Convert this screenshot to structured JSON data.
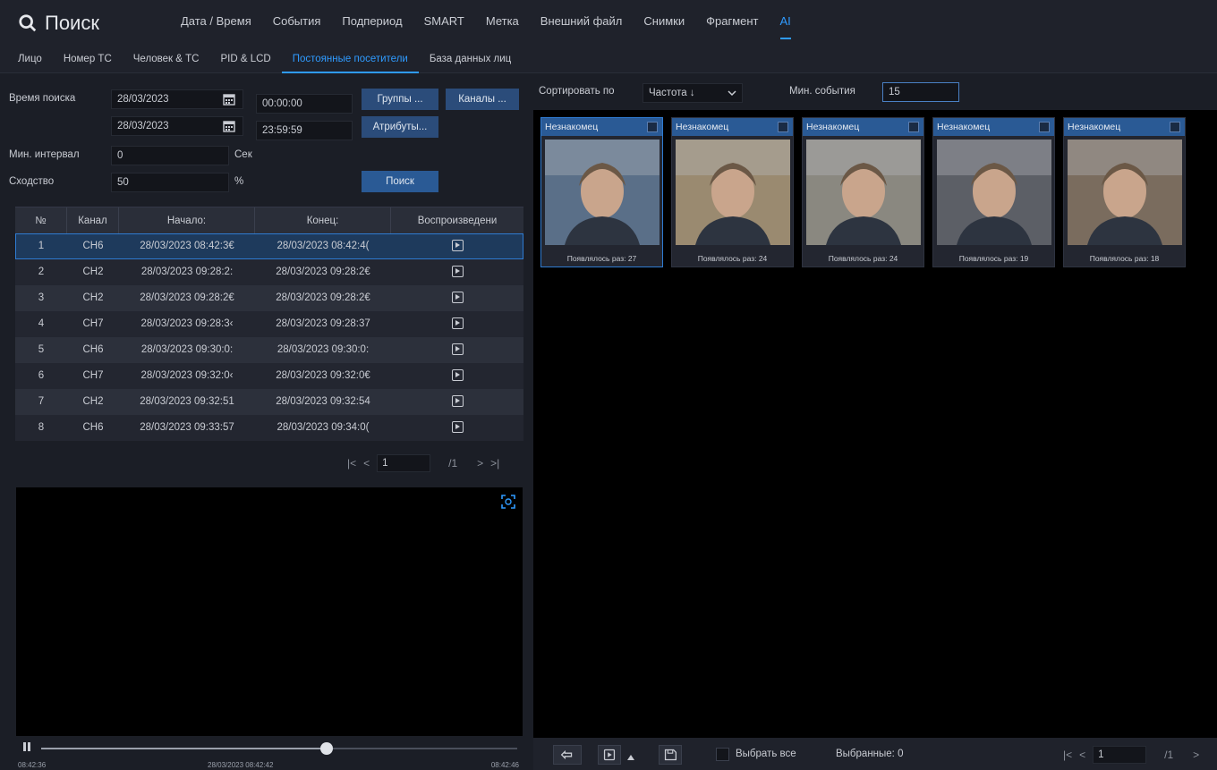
{
  "header": {
    "title": "Поиск",
    "tabs": [
      {
        "label": "Дата / Время",
        "active": false
      },
      {
        "label": "События",
        "active": false
      },
      {
        "label": "Подпериод",
        "active": false
      },
      {
        "label": "SMART",
        "active": false
      },
      {
        "label": "Метка",
        "active": false
      },
      {
        "label": "Внешний файл",
        "active": false
      },
      {
        "label": "Снимки",
        "active": false
      },
      {
        "label": "Фрагмент",
        "active": false
      },
      {
        "label": "AI",
        "active": true
      }
    ]
  },
  "subtabs": [
    {
      "label": "Лицо",
      "active": false
    },
    {
      "label": "Номер ТС",
      "active": false
    },
    {
      "label": "Человек & ТС",
      "active": false
    },
    {
      "label": "PID & LCD",
      "active": false
    },
    {
      "label": "Постоянные посетители",
      "active": true
    },
    {
      "label": "База данных лиц",
      "active": false
    }
  ],
  "search_form": {
    "time_label": "Время поиска",
    "start_date": "28/03/2023",
    "start_time": "00:00:00",
    "end_date": "28/03/2023",
    "end_time": "23:59:59",
    "groups_btn": "Группы ...",
    "channels_btn": "Каналы ...",
    "attributes_btn": "Атрибуты...",
    "min_interval_label": "Мин. интервал",
    "min_interval_value": "0",
    "min_interval_unit": "Сек",
    "similarity_label": "Сходство",
    "similarity_value": "50",
    "similarity_unit": "%",
    "search_btn": "Поиск"
  },
  "table": {
    "headers": [
      "№",
      "Канал",
      "Начало:",
      "Конец:",
      "Воспроизведени"
    ],
    "rows": [
      {
        "n": "1",
        "ch": "CH6",
        "start": "28/03/2023 08:42:3€",
        "end": "28/03/2023 08:42:4(",
        "selected": true
      },
      {
        "n": "2",
        "ch": "CH2",
        "start": "28/03/2023 09:28:2:",
        "end": "28/03/2023 09:28:2€",
        "selected": false
      },
      {
        "n": "3",
        "ch": "CH2",
        "start": "28/03/2023 09:28:2€",
        "end": "28/03/2023 09:28:2€",
        "selected": false
      },
      {
        "n": "4",
        "ch": "CH7",
        "start": "28/03/2023 09:28:3‹",
        "end": "28/03/2023 09:28:37",
        "selected": false
      },
      {
        "n": "5",
        "ch": "CH6",
        "start": "28/03/2023 09:30:0:",
        "end": "28/03/2023 09:30:0:",
        "selected": false
      },
      {
        "n": "6",
        "ch": "CH7",
        "start": "28/03/2023 09:32:0‹",
        "end": "28/03/2023 09:32:0€",
        "selected": false
      },
      {
        "n": "7",
        "ch": "CH2",
        "start": "28/03/2023 09:32:51",
        "end": "28/03/2023 09:32:54",
        "selected": false
      },
      {
        "n": "8",
        "ch": "CH6",
        "start": "28/03/2023 09:33:57",
        "end": "28/03/2023 09:34:0(",
        "selected": false
      }
    ]
  },
  "left_pager": {
    "first": "|<",
    "prev": "<",
    "page": "1",
    "total": "/1",
    "next": ">",
    "last": ">|"
  },
  "playback": {
    "progress": 0.6,
    "time_start": "08:42:36",
    "time_current": "28/03/2023 08:42:42",
    "time_end": "08:42:46"
  },
  "right_panel": {
    "sort_label": "Сортировать по",
    "sort_value": "Частота ↓",
    "min_events_label": "Мин. события",
    "min_events_value": "15",
    "cards": [
      {
        "title": "Незнакомец",
        "caption": "Появлялось раз: 27",
        "selected": true,
        "tone": "#5a6f88"
      },
      {
        "title": "Незнакомец",
        "caption": "Появлялось раз: 24",
        "selected": false,
        "tone": "#9a8a70"
      },
      {
        "title": "Незнакомец",
        "caption": "Появлялось раз: 24",
        "selected": false,
        "tone": "#8a8880"
      },
      {
        "title": "Незнакомец",
        "caption": "Появлялось раз: 19",
        "selected": false,
        "tone": "#5c5f66"
      },
      {
        "title": "Незнакомец",
        "caption": "Появлялось раз: 18",
        "selected": false,
        "tone": "#7a6c5e"
      }
    ],
    "select_all": "Выбрать все",
    "selected_count": "Выбранные: 0",
    "pager": {
      "first": "|<",
      "prev": "<",
      "page": "1",
      "total": "/1",
      "next": ">"
    }
  }
}
